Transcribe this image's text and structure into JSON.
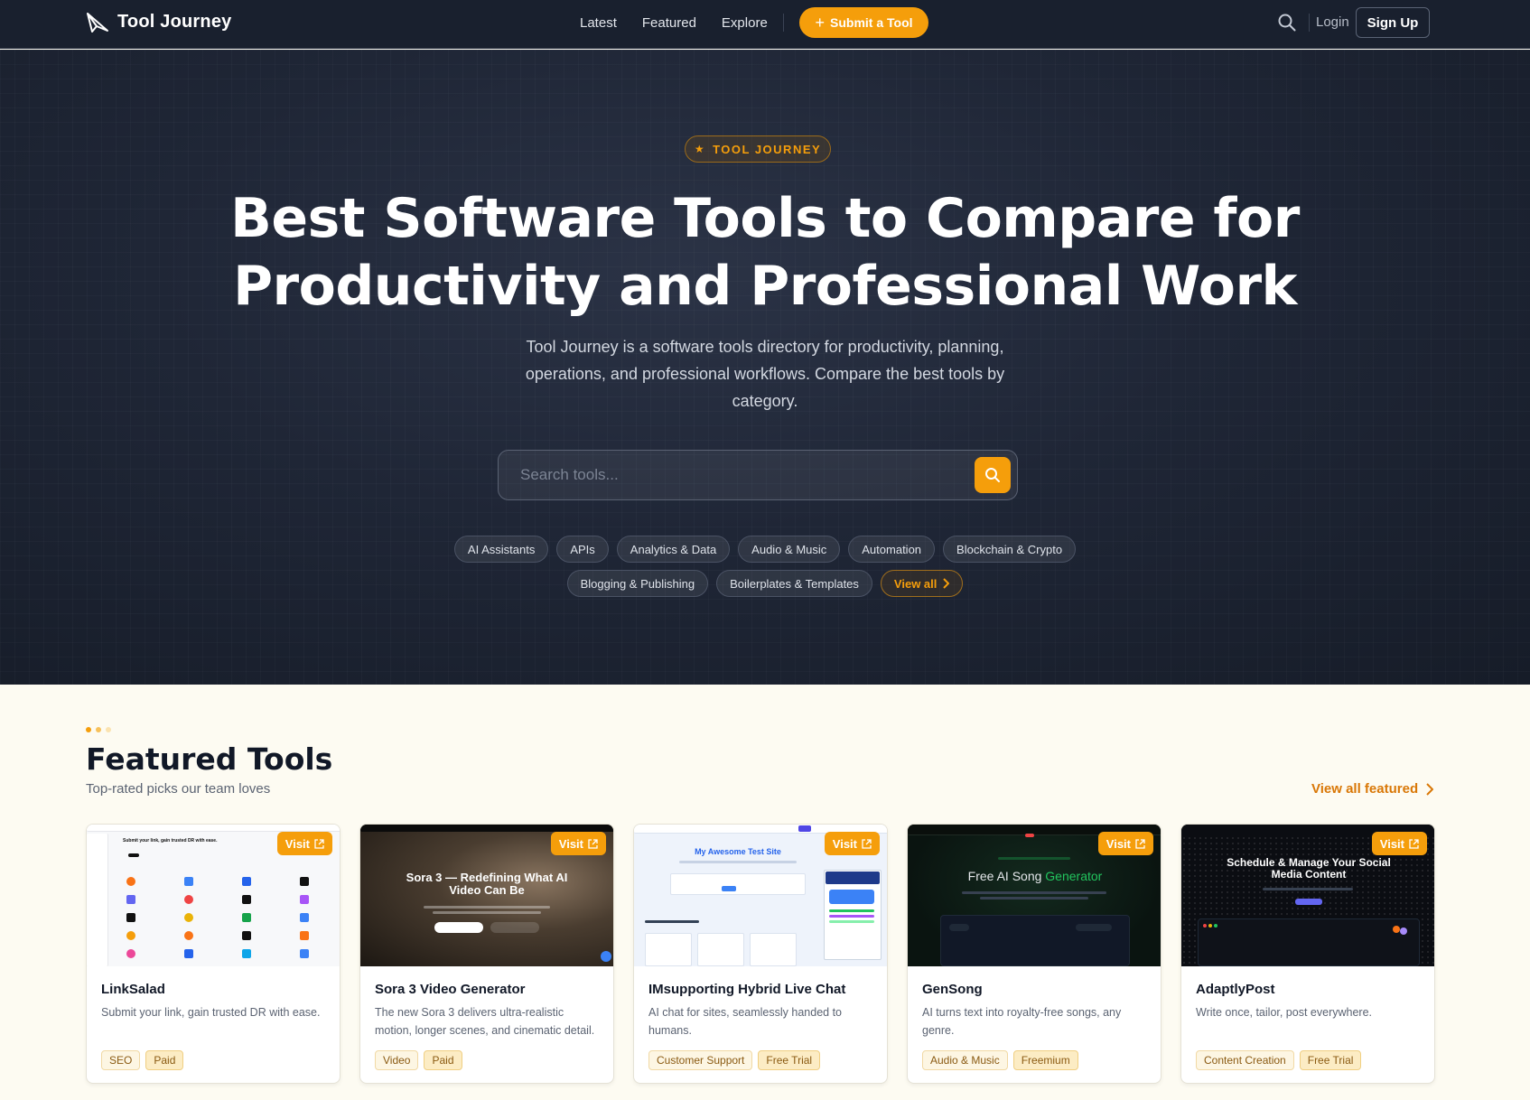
{
  "nav": {
    "brand": "Tool Journey",
    "links": [
      "Latest",
      "Featured",
      "Explore"
    ],
    "submit_label": "Submit a Tool",
    "login_label": "Login",
    "signup_label": "Sign Up"
  },
  "hero": {
    "badge": "TOOL JOURNEY",
    "title_line1": "Best Software Tools to Compare for",
    "title_line2": "Productivity and Professional Work",
    "subtitle": "Tool Journey is a software tools directory for productivity, planning, operations, and professional workflows. Compare the best tools by category.",
    "search_placeholder": "Search tools...",
    "categories_row1": [
      "AI Assistants",
      "APIs",
      "Analytics & Data",
      "Audio & Music",
      "Automation",
      "Blockchain & Crypto"
    ],
    "categories_row2": [
      "Blogging & Publishing",
      "Boilerplates & Templates"
    ],
    "view_all_label": "View all"
  },
  "featured": {
    "title": "Featured Tools",
    "subtitle": "Top-rated picks our team loves",
    "view_all_label": "View all featured",
    "visit_label": "Visit",
    "cards": [
      {
        "name": "LinkSalad",
        "desc": "Submit your link, gain trusted DR with ease.",
        "category": "SEO",
        "pricing": "Paid",
        "thumb_headline": "Submit your link, gain trusted DR with ease."
      },
      {
        "name": "Sora 3 Video Generator",
        "desc": "The new Sora 3 delivers ultra-realistic motion, longer scenes, and cinematic detail.",
        "category": "Video",
        "pricing": "Paid",
        "thumb_headline": "Sora 3 — Redefining What AI Video Can Be"
      },
      {
        "name": "IMsupporting Hybrid Live Chat",
        "desc": "AI chat for sites, seamlessly handed to humans.",
        "category": "Customer Support",
        "pricing": "Free Trial",
        "thumb_headline": "My Awesome Test Site"
      },
      {
        "name": "GenSong",
        "desc": "AI turns text into royalty-free songs, any genre.",
        "category": "Audio & Music",
        "pricing": "Freemium",
        "thumb_headline_a": "Free AI Song",
        "thumb_headline_b": "Generator"
      },
      {
        "name": "AdaptlyPost",
        "desc": "Write once, tailor, post everywhere.",
        "category": "Content Creation",
        "pricing": "Free Trial",
        "thumb_headline": "Schedule & Manage Your Social Media Content"
      }
    ]
  },
  "colors": {
    "accent": "#f59e0b",
    "nav_bg": "#19202e",
    "hero_bg": "#1f2636",
    "page_bg": "#fdfbf2"
  },
  "icons": [
    "logo-paper-plane-icon",
    "search-icon",
    "plus-icon",
    "star-icon",
    "chevron-right-icon",
    "external-link-icon"
  ]
}
